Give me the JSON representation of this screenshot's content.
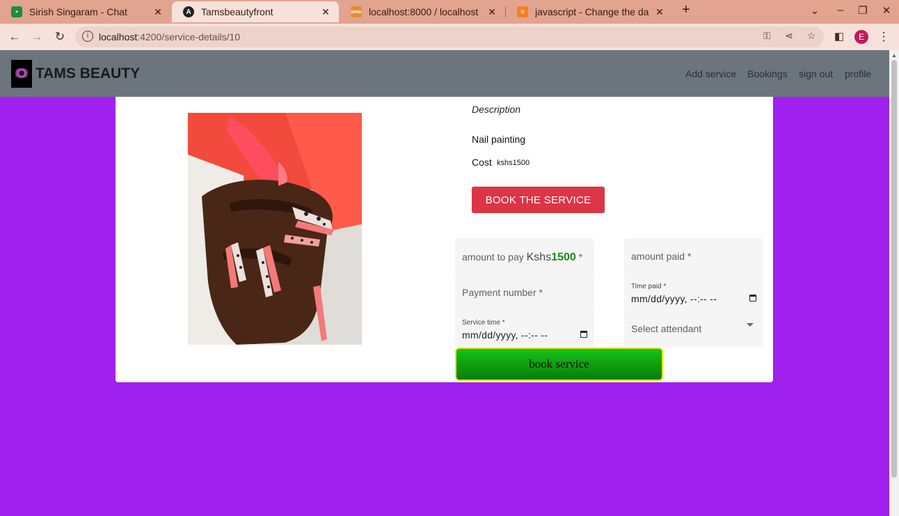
{
  "browser": {
    "tabs": [
      {
        "title": "Sirish Singaram - Chat",
        "favicon": "chat-favicon",
        "active": false
      },
      {
        "title": "Tamsbeautyfront",
        "favicon": "angular-favicon",
        "active": true
      },
      {
        "title": "localhost:8000 / localhost",
        "favicon": "phpmyadmin-favicon",
        "active": false
      },
      {
        "title": "javascript - Change the da",
        "favicon": "stackoverflow-favicon",
        "active": false
      }
    ],
    "new_tab_label": "+",
    "url_host": "localhost",
    "url_path": ":4200/service-details/10",
    "profile_initial": "E"
  },
  "navbar": {
    "brand": "TAMS BEAUTY",
    "links": [
      "Add service",
      "Bookings",
      "sign out",
      "profile"
    ]
  },
  "service": {
    "description_label": "Description",
    "name": "Nail painting",
    "cost_label": "Cost",
    "cost_value": "kshs1500",
    "book_button": "BOOK THE SERVICE"
  },
  "form": {
    "amount_to_pay_label": "amount to pay",
    "amount_currency": "Kshs",
    "amount_value": "1500",
    "amount_paid_label": "amount paid",
    "payment_number_label": "Payment number",
    "time_paid_label": "Time paid",
    "service_time_label": "Service time",
    "datetime_placeholder": "mm/dd/yyyy, --:-- --",
    "select_attendant_label": "Select attendant",
    "required_mark": " *",
    "submit_label": "book service"
  },
  "colors": {
    "page_bg": "#a020f0",
    "navbar_bg": "#6c757d",
    "book_button": "#dc3545",
    "submit_green": "#11aa11",
    "submit_border": "#e6e600",
    "amount_green": "#1a8c1a"
  }
}
